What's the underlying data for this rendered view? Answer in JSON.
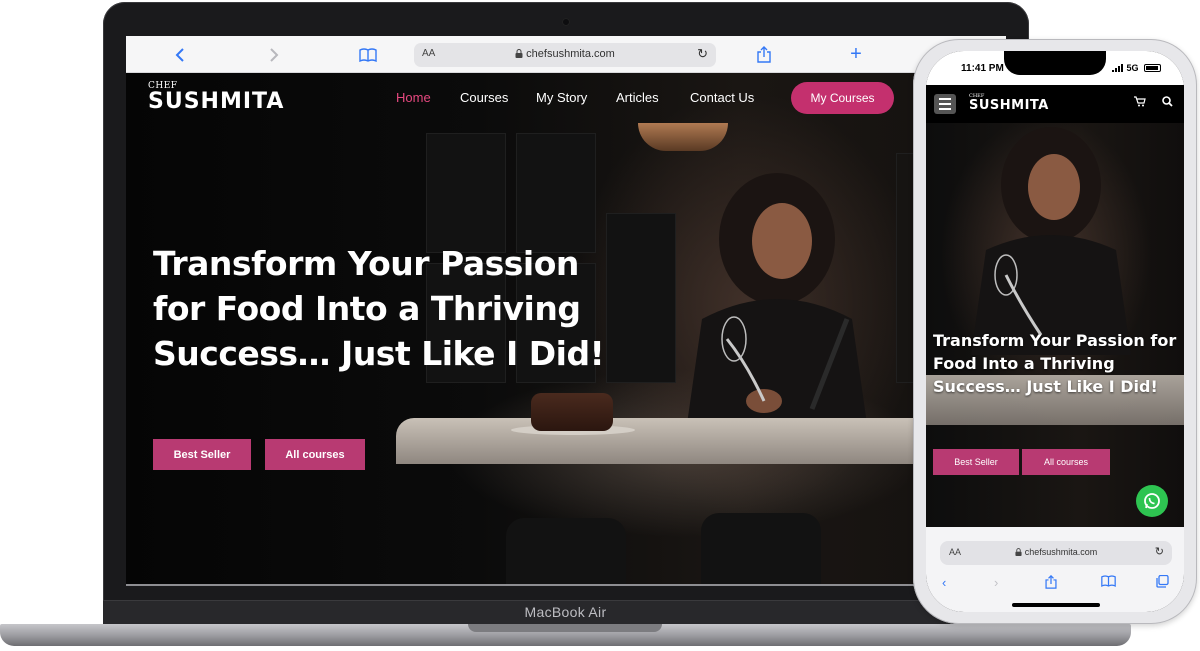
{
  "laptop": {
    "model_label": "MacBook Air",
    "browser": {
      "text_size_label": "AA",
      "url": "chefsushmita.com",
      "back_icon": "chevron-left-icon",
      "forward_icon": "chevron-right-icon",
      "bookmarks_icon": "book-icon",
      "share_icon": "share-icon",
      "new_tab_icon": "plus-icon"
    },
    "site": {
      "logo_small": "CHEF",
      "logo_big": "SUSHMITA",
      "nav": [
        "Home",
        "Courses",
        "My Story",
        "Articles",
        "Contact Us"
      ],
      "active_nav": "Home",
      "cta": "My Courses",
      "hero_title": "Transform Your Passion for Food Into a Thriving Success… Just Like I Did!",
      "buttons": [
        "Best Seller",
        "All courses"
      ]
    }
  },
  "phone": {
    "status": {
      "time": "11:41 PM",
      "network": "5G"
    },
    "site": {
      "logo_small": "CHEF",
      "logo_big": "SUSHMITA",
      "hero_title": "Transform Your Passion for Food Into a Thriving Success… Just Like I Did!",
      "buttons": [
        "Best Seller",
        "All courses"
      ]
    },
    "browser": {
      "text_size_label": "AA",
      "url": "chefsushmita.com"
    }
  },
  "colors": {
    "brand_pink": "#c4306e",
    "active_link": "#e6487f",
    "whatsapp": "#2ec451",
    "ios_blue": "#3478f6"
  }
}
